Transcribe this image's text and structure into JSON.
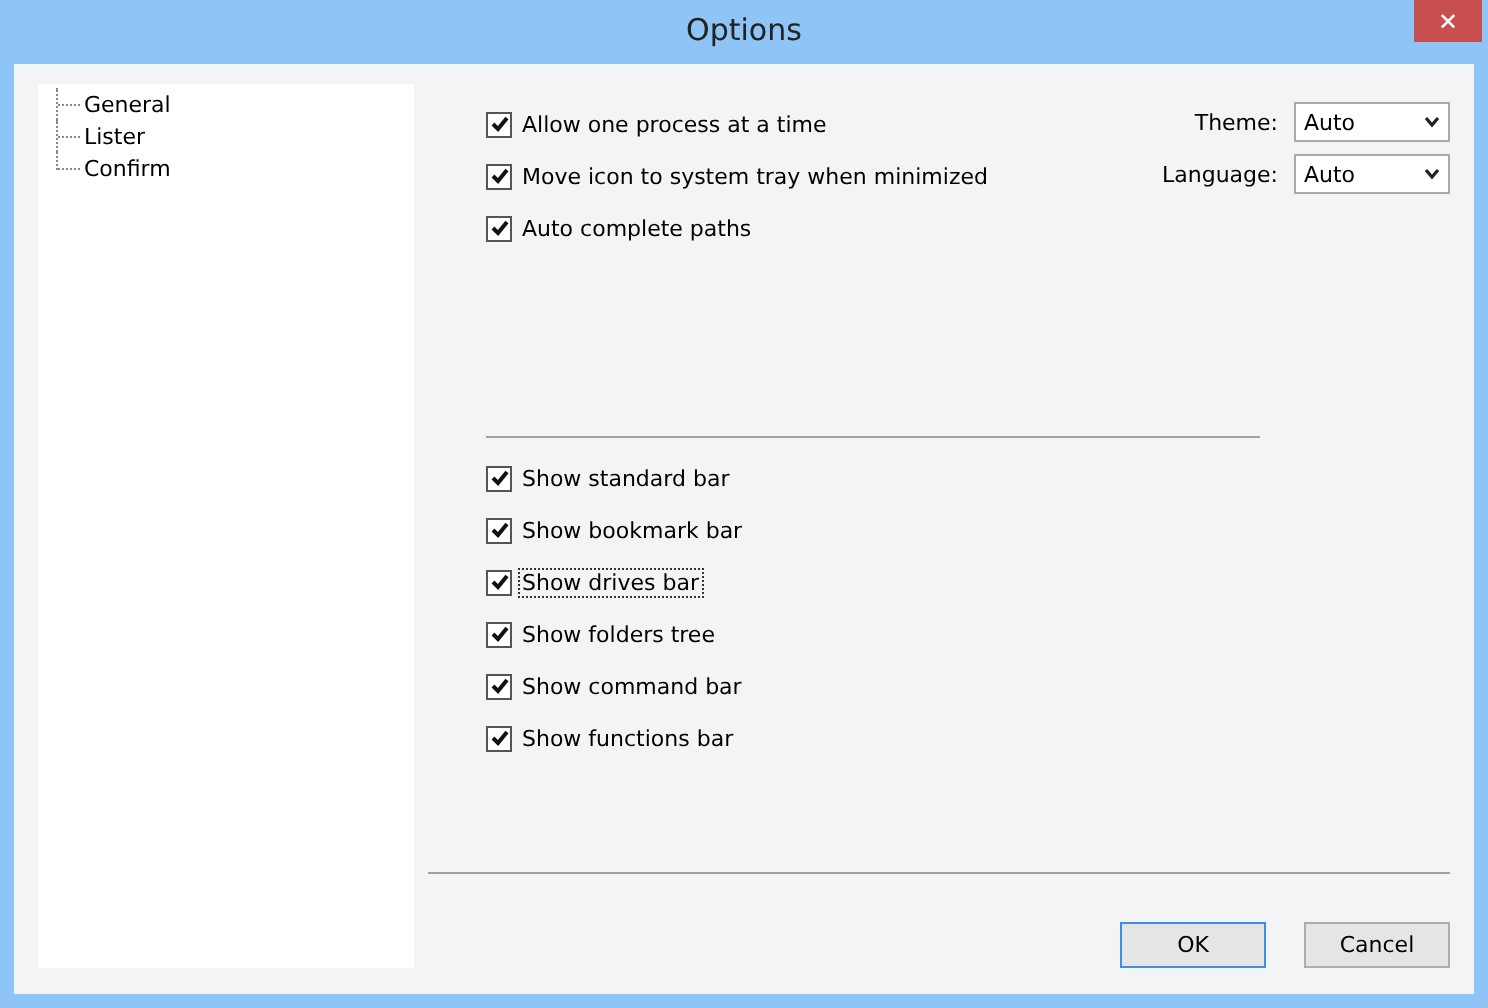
{
  "window": {
    "title": "Options",
    "close": "✕"
  },
  "tree": [
    {
      "label": "General"
    },
    {
      "label": "Lister"
    },
    {
      "label": "Confirm"
    }
  ],
  "general_options": [
    {
      "label": "Allow one process at a time",
      "checked": true,
      "focused": false
    },
    {
      "label": "Move icon to system tray when minimized",
      "checked": true,
      "focused": false
    },
    {
      "label": "Auto complete paths",
      "checked": true,
      "focused": false
    }
  ],
  "selects": [
    {
      "label": "Theme:",
      "value": "Auto"
    },
    {
      "label": "Language:",
      "value": "Auto"
    }
  ],
  "bar_options": [
    {
      "label": "Show standard bar",
      "checked": true,
      "focused": false
    },
    {
      "label": "Show bookmark bar",
      "checked": true,
      "focused": false
    },
    {
      "label": "Show drives bar",
      "checked": true,
      "focused": true
    },
    {
      "label": "Show folders tree",
      "checked": true,
      "focused": false
    },
    {
      "label": "Show command bar",
      "checked": true,
      "focused": false
    },
    {
      "label": "Show functions bar",
      "checked": true,
      "focused": false
    }
  ],
  "buttons": [
    {
      "label": "OK",
      "default": true
    },
    {
      "label": "Cancel",
      "default": false
    }
  ]
}
